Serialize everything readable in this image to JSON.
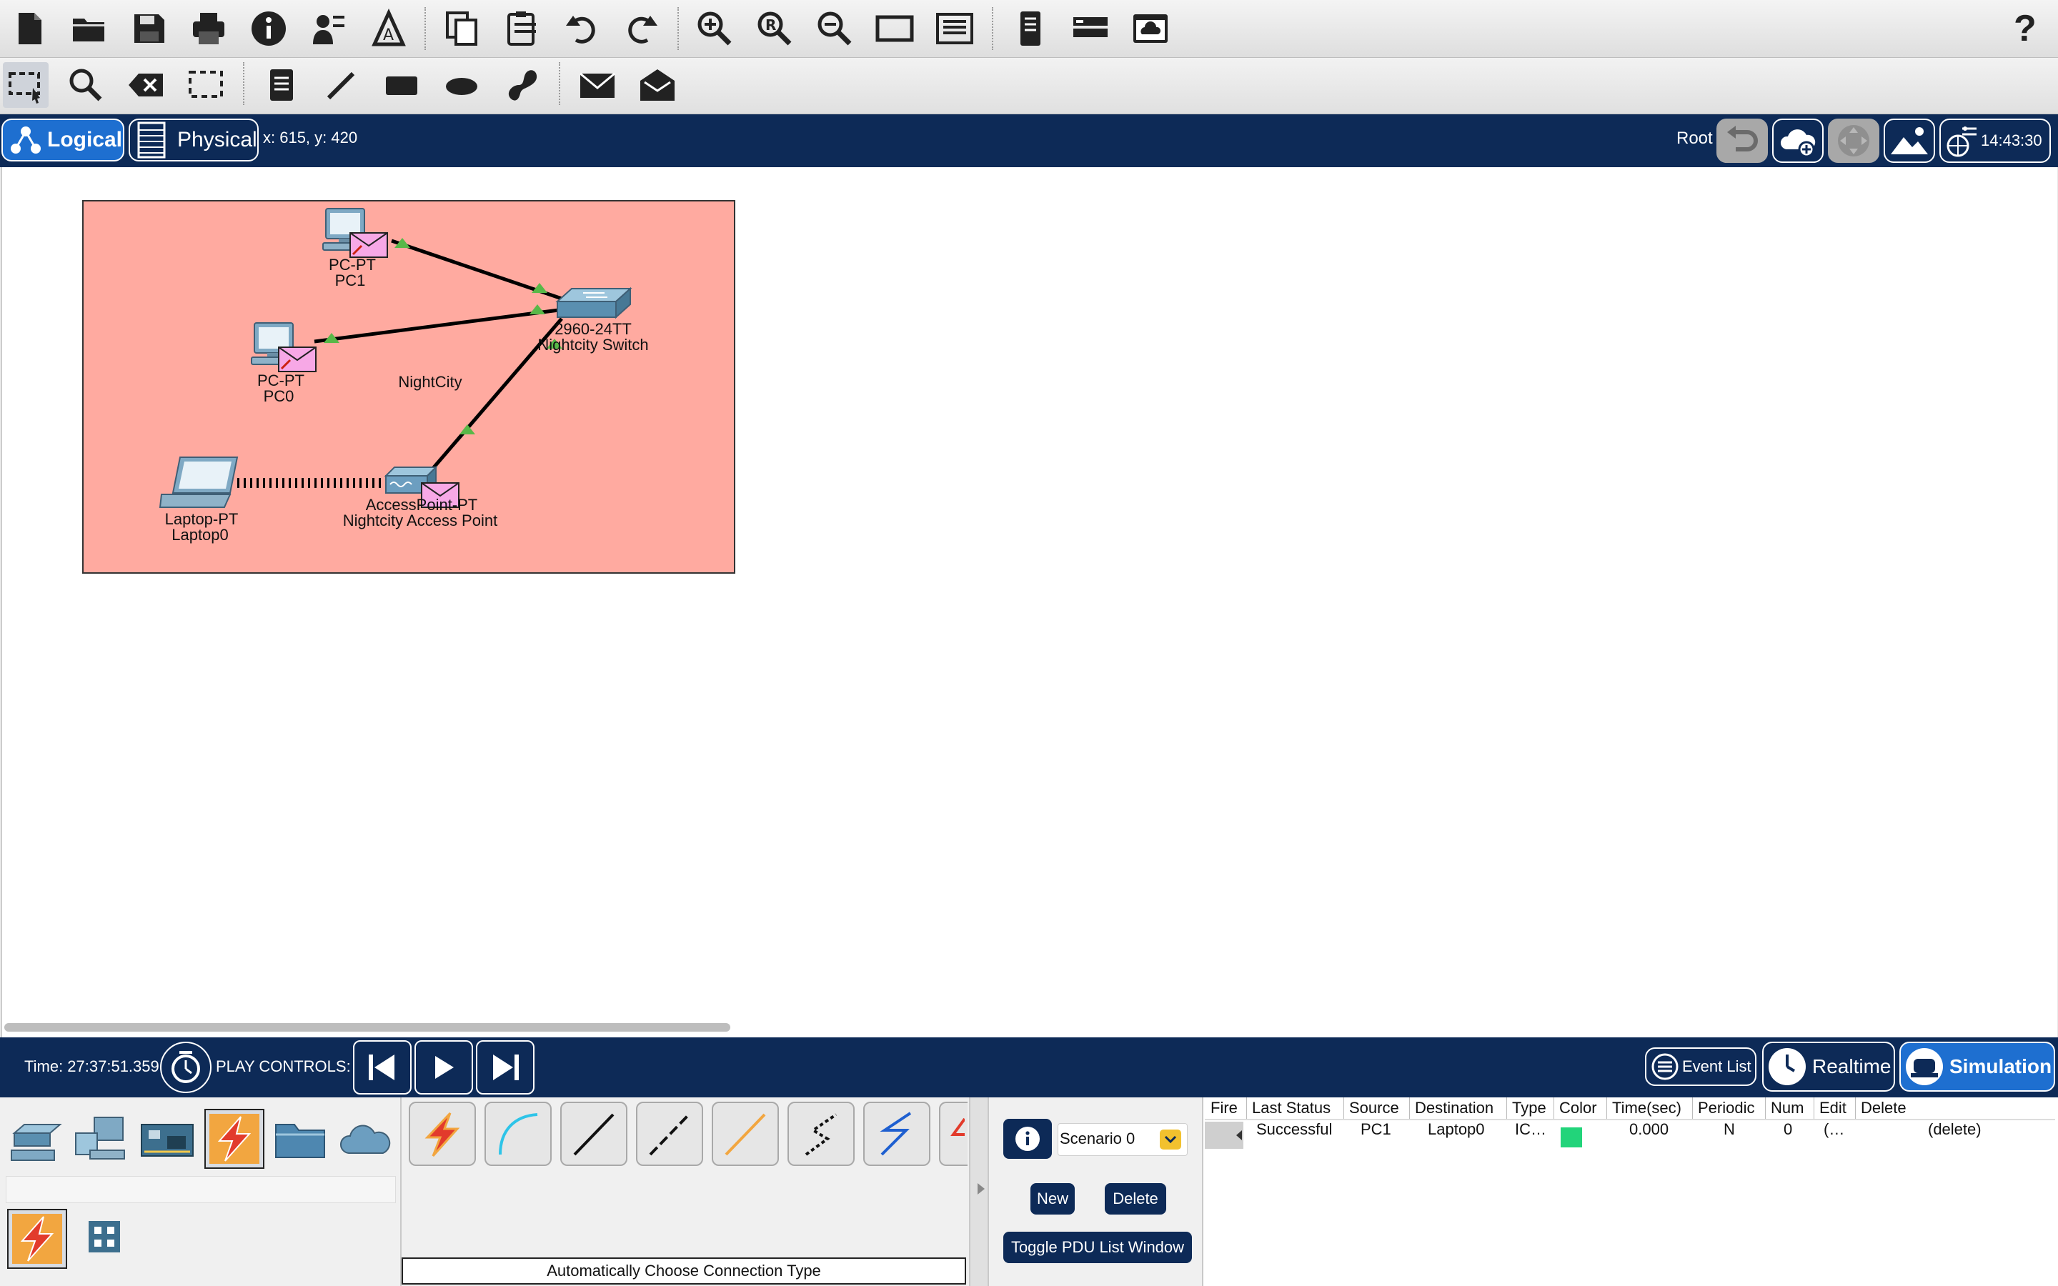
{
  "main_toolbar": {
    "items": [
      "new-file",
      "open-folder",
      "save",
      "print",
      "info",
      "activity-wizard",
      "network-info",
      "copy",
      "paste",
      "undo",
      "redo",
      "zoom-in",
      "zoom-reset",
      "zoom-out",
      "palette",
      "custom-device",
      "tablet",
      "server",
      "cloud-view"
    ],
    "help_label": "?"
  },
  "common_toolbar": {
    "items": [
      "select",
      "inspect",
      "delete",
      "resize",
      "note",
      "draw-line",
      "draw-rectangle",
      "draw-ellipse",
      "freeform",
      "add-simple-pdu",
      "add-complex-pdu"
    ]
  },
  "navbar": {
    "logical_label": "Logical",
    "physical_label": "Physical",
    "coords": "x: 615, y: 420",
    "root_label": "Root",
    "clock": "14:43:30"
  },
  "topology": {
    "cluster_name": "NightCity",
    "devices": [
      {
        "id": "pc1",
        "type": "PC-PT",
        "name": "PC1"
      },
      {
        "id": "pc0",
        "type": "PC-PT",
        "name": "PC0"
      },
      {
        "id": "switch",
        "type": "2960-24TT",
        "name": "Nightcity Switch"
      },
      {
        "id": "ap",
        "type": "AccessPoint-PT",
        "name": "Nightcity Access Point"
      },
      {
        "id": "laptop",
        "type": "Laptop-PT",
        "name": "Laptop0"
      }
    ]
  },
  "sim_bar": {
    "time": "Time: 27:37:51.359",
    "play_controls_label": "PLAY CONTROLS:",
    "event_list_label": "Event List",
    "realtime_label": "Realtime",
    "simulation_label": "Simulation"
  },
  "device_panel": {
    "connection_type_label": "Automatically Choose Connection Type"
  },
  "scenario": {
    "selected": "Scenario 0",
    "new_label": "New",
    "delete_label": "Delete",
    "toggle_label": "Toggle PDU List Window"
  },
  "pdu_table": {
    "headers": [
      "Fire",
      "Last Status",
      "Source",
      "Destination",
      "Type",
      "Color",
      "Time(sec)",
      "Periodic",
      "Num",
      "Edit",
      "Delete"
    ],
    "rows": [
      {
        "fire": "",
        "status": "Successful",
        "source": "PC1",
        "destination": "Laptop0",
        "type": "IC…",
        "color": "#22d47a",
        "time": "0.000",
        "periodic": "N",
        "num": "0",
        "edit": "(…",
        "delete": "(delete)"
      }
    ]
  }
}
